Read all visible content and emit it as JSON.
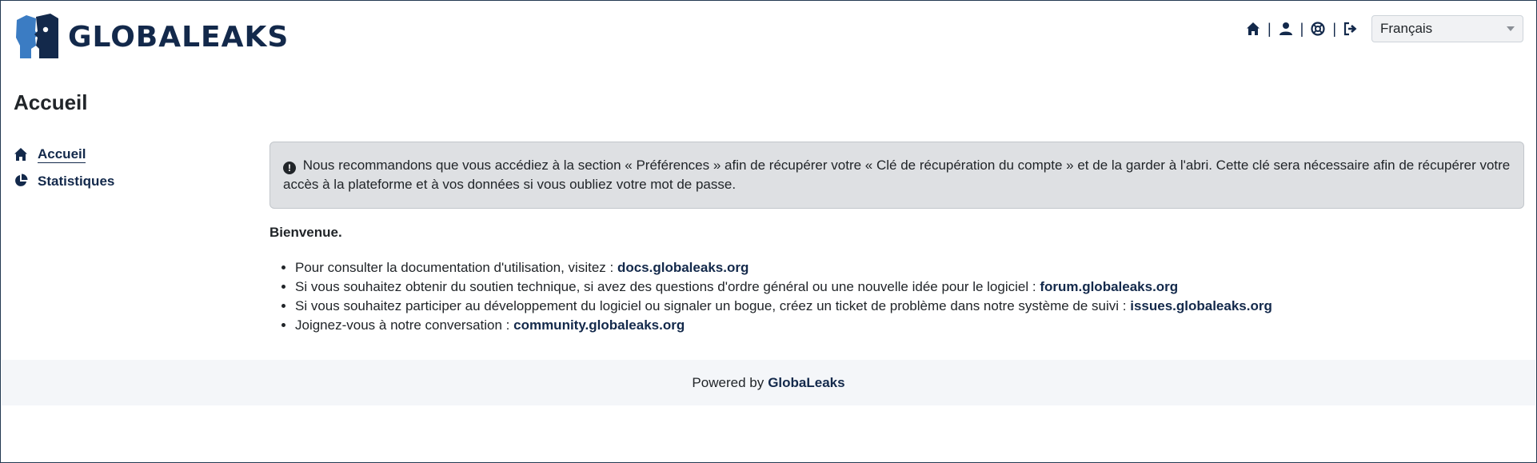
{
  "brand": {
    "name": "GLOBALEAKS"
  },
  "topbar": {
    "icons": [
      "home-icon",
      "user-icon",
      "support-icon",
      "logout-icon"
    ],
    "separator": "|",
    "language": "Français"
  },
  "page": {
    "title": "Accueil"
  },
  "sidebar": {
    "items": [
      {
        "label": "Accueil",
        "icon": "home-icon"
      },
      {
        "label": "Statistiques",
        "icon": "pie-chart-icon"
      }
    ]
  },
  "alert": {
    "text": "Nous recommandons que vous accédiez à la section « Préférences » afin de récupérer votre « Clé de récupération du compte » et de la garder à l'abri. Cette clé sera nécessaire afin de récupérer votre accès à la plateforme et à vos données si vous oubliez votre mot de passe."
  },
  "welcome": "Bienvenue.",
  "links": [
    {
      "text": "Pour consulter la documentation d'utilisation, visitez : ",
      "link": "docs.globaleaks.org"
    },
    {
      "text": "Si vous souhaitez obtenir du soutien technique, si avez des questions d'ordre général ou une nouvelle idée pour le logiciel : ",
      "link": "forum.globaleaks.org"
    },
    {
      "text": "Si vous souhaitez participer au développement du logiciel ou signaler un bogue, créez un ticket de problème dans notre système de suivi : ",
      "link": "issues.globaleaks.org"
    },
    {
      "text": "Joignez-vous à notre conversation : ",
      "link": "community.globaleaks.org"
    }
  ],
  "footer": {
    "prefix": "Powered by",
    "brand": "GlobaLeaks"
  },
  "colors": {
    "brand": "#13294b",
    "logo_light": "#3b7cc3",
    "alert_bg": "#dee0e3",
    "footer_bg": "#f4f6f9"
  }
}
